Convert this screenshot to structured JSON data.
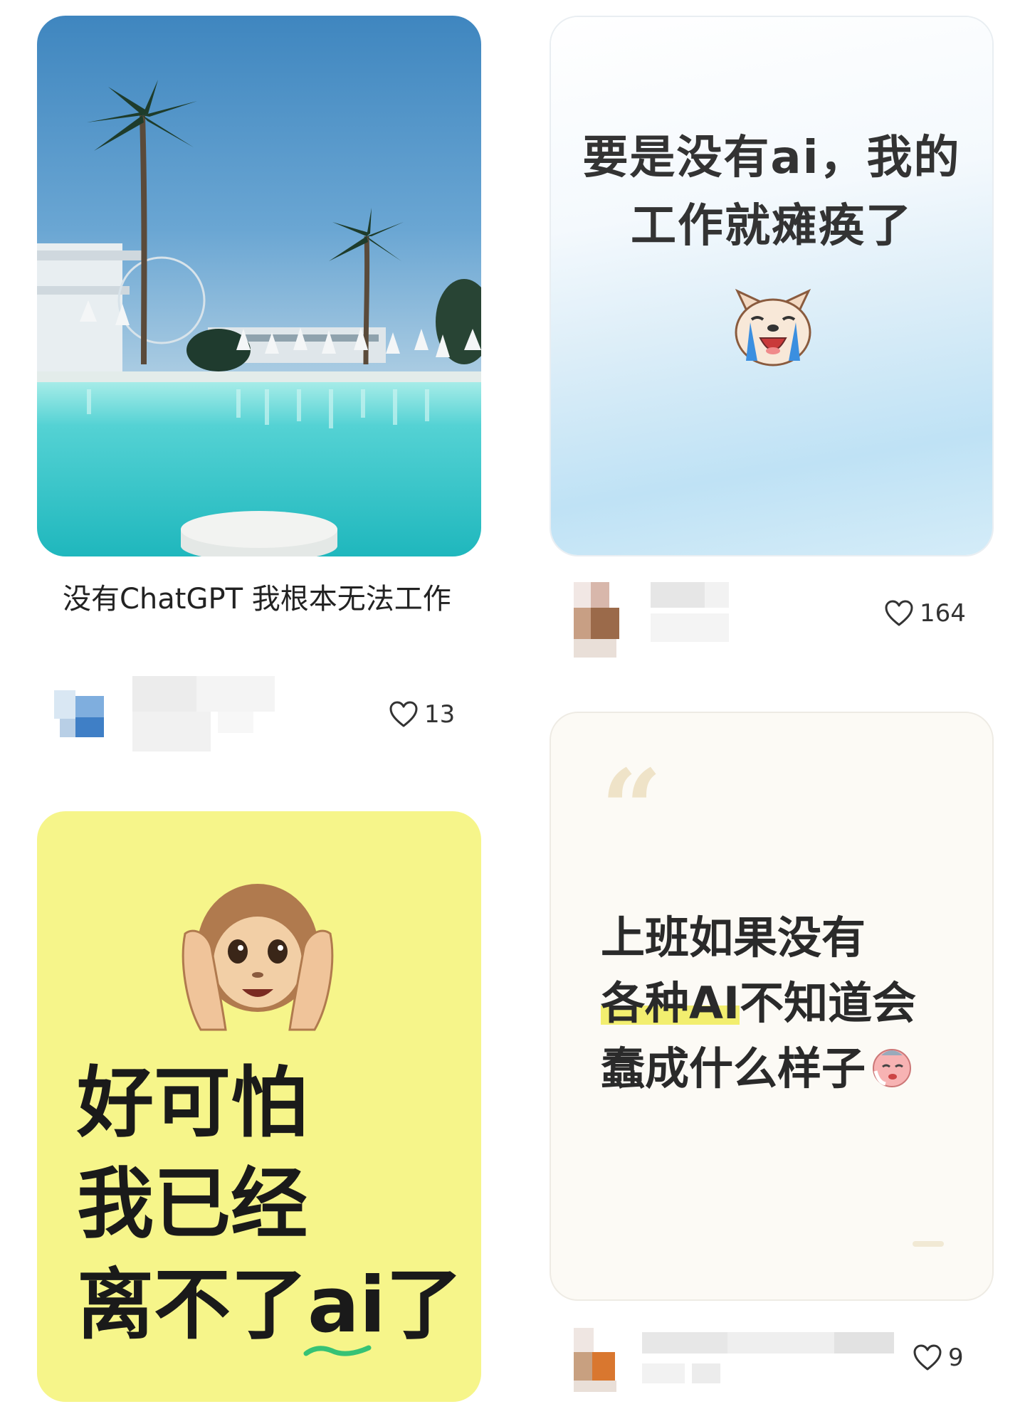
{
  "feed": {
    "cards": [
      {
        "image_desc_colors": {
          "sky": "#4f90c4",
          "water": "#2fc4c9"
        },
        "title": "没有ChatGPT 我根本无法工作",
        "likes": "13"
      },
      {
        "text_lines": [
          "要是没有ai，我的",
          "工作就瘫痪了"
        ],
        "likes": "164"
      },
      {
        "text_lines": [
          "好可怕",
          "我已经",
          "离不了",
          "ai",
          "了"
        ],
        "bg_color": "#f6f58a"
      },
      {
        "quote_mark": "“",
        "text_line1": "上班如果没有",
        "text_line2_highlight": "各种AI",
        "text_line2_rest": "不知道会",
        "text_line3": "蠢成什么样子",
        "likes": "9"
      }
    ]
  },
  "icons": {
    "like": "heart-outline-icon"
  }
}
